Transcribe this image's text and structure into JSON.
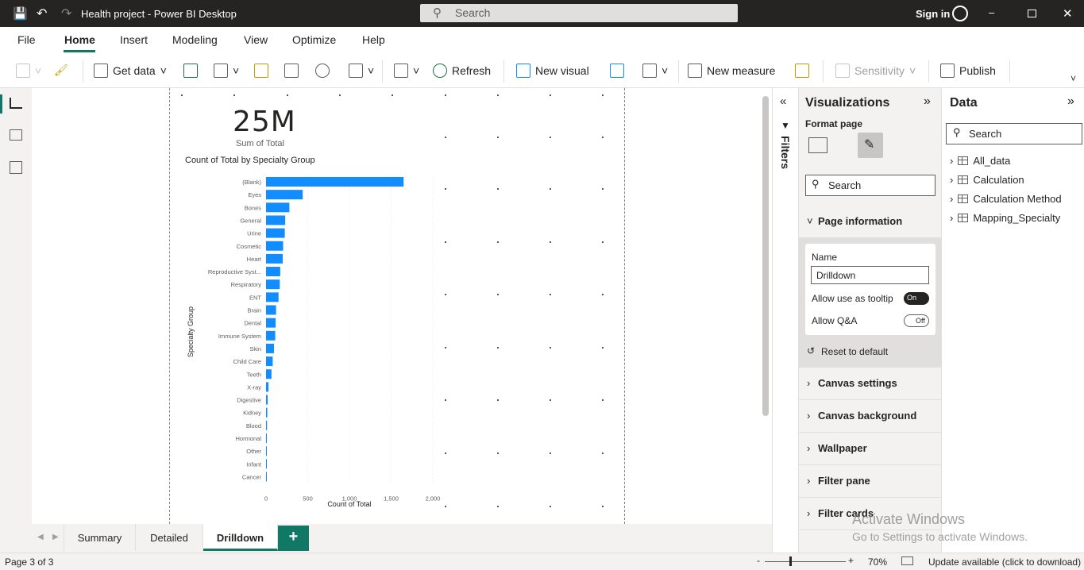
{
  "window": {
    "title": "Health project - Power BI Desktop",
    "search_placeholder": "Search",
    "signin": "Sign in"
  },
  "menu": [
    "File",
    "Home",
    "Insert",
    "Modeling",
    "View",
    "Optimize",
    "Help"
  ],
  "ribbon": {
    "get_data": "Get data",
    "refresh": "Refresh",
    "new_visual": "New visual",
    "new_measure": "New measure",
    "sensitivity": "Sensitivity",
    "publish": "Publish"
  },
  "card": {
    "value": "25M",
    "label": "Sum of Total"
  },
  "chart_data": {
    "type": "bar",
    "orientation": "horizontal",
    "title": "Count of Total by Specialty Group",
    "xlabel": "Count of Total",
    "ylabel": "Specialty Group",
    "xlim": [
      0,
      2000
    ],
    "xticks": [
      "0",
      "500",
      "1,000",
      "1,500",
      "2,000"
    ],
    "color": "#118dff",
    "categories": [
      "(Blank)",
      "Eyes",
      "Bones",
      "General",
      "Urine",
      "Cosmetic",
      "Heart",
      "Reproductive Syst...",
      "Respiratory",
      "ENT",
      "Brain",
      "Dental",
      "Immune System",
      "Skin",
      "Child Care",
      "Teeth",
      "X-ray",
      "Digestive",
      "Kidney",
      "Blood",
      "Hormonal",
      "Other",
      "Infant",
      "Cancer"
    ],
    "values": [
      1650,
      440,
      280,
      230,
      225,
      205,
      200,
      170,
      165,
      150,
      120,
      115,
      110,
      95,
      80,
      65,
      30,
      20,
      15,
      12,
      10,
      8,
      5,
      3
    ]
  },
  "filters": {
    "label": "Filters"
  },
  "viz": {
    "title": "Visualizations",
    "format_page": "Format page",
    "search": "Search",
    "page_information": "Page information",
    "name_label": "Name",
    "name_value": "Drilldown",
    "tooltip_label": "Allow use as tooltip",
    "tooltip_state": "On",
    "qa_label": "Allow Q&A",
    "qa_state": "Off",
    "reset": "Reset to default",
    "sections": [
      "Canvas settings",
      "Canvas background",
      "Wallpaper",
      "Filter pane",
      "Filter cards"
    ]
  },
  "data": {
    "title": "Data",
    "search": "Search",
    "tables": [
      "All_data",
      "Calculation",
      "Calculation Method",
      "Mapping_Specialty"
    ]
  },
  "tabs": [
    "Summary",
    "Detailed",
    "Drilldown"
  ],
  "status": {
    "page": "Page 3 of 3",
    "zoom": "70%",
    "update": "Update available (click to download)"
  },
  "watermark": {
    "line1": "Activate Windows",
    "line2": "Go to Settings to activate Windows."
  }
}
